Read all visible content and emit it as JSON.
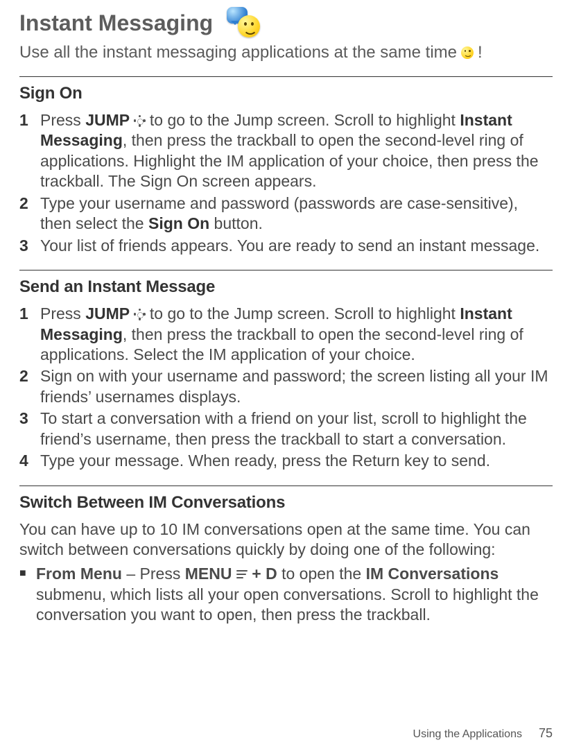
{
  "title": "Instant Messaging",
  "intro_prefix": "Use all the instant messaging applications at the same time",
  "intro_suffix": "!",
  "sections": {
    "sign_on": {
      "heading": "Sign On",
      "steps": [
        {
          "num": "1",
          "pre": "Press ",
          "k1": "JUMP",
          "mid1": " to go to the Jump screen. Scroll to highlight ",
          "k2": "Instant Messaging",
          "tail": ", then press the trackball to open the second-level ring of applications. Highlight the IM application of your choice, then press the trackball. The Sign On screen appears."
        },
        {
          "num": "2",
          "pre": "Type your username and password (passwords are case-sensitive), then select the ",
          "k1": "Sign On",
          "tail": " button."
        },
        {
          "num": "3",
          "pre": "Your list of friends appears. You are ready to send an instant message."
        }
      ]
    },
    "send": {
      "heading": "Send an Instant Message",
      "steps": [
        {
          "num": "1",
          "pre": "Press ",
          "k1": "JUMP",
          "mid1": " to go to the Jump screen. Scroll to highlight ",
          "k2": "Instant Messaging",
          "tail": ", then press the trackball to open the second-level ring of applications. Select the IM application of your choice."
        },
        {
          "num": "2",
          "pre": "Sign on with your username and password; the screen listing all your IM friends’ usernames displays."
        },
        {
          "num": "3",
          "pre": "To start a conversation with a friend on your list, scroll to highlight the friend’s username, then press the trackball to start a conversation."
        },
        {
          "num": "4",
          "pre": "Type your message. When ready, press the Return key to send."
        }
      ]
    },
    "switch": {
      "heading": "Switch Between IM Conversations",
      "intro": "You can have up to 10 IM conversations open at the same time. You can switch between conversations quickly by doing one of the following:",
      "bullets": [
        {
          "lead": "From Menu",
          "dash": " – Press ",
          "k1": "MENU",
          "mid1": " + ",
          "k2": "D",
          "mid2": " to open the ",
          "k3": "IM Conversations",
          "tail": " submenu, which lists all your open conversations. Scroll to highlight the conversation you want to open, then press the trackball."
        }
      ]
    }
  },
  "footer": {
    "section": "Using the Applications",
    "page": "75"
  }
}
